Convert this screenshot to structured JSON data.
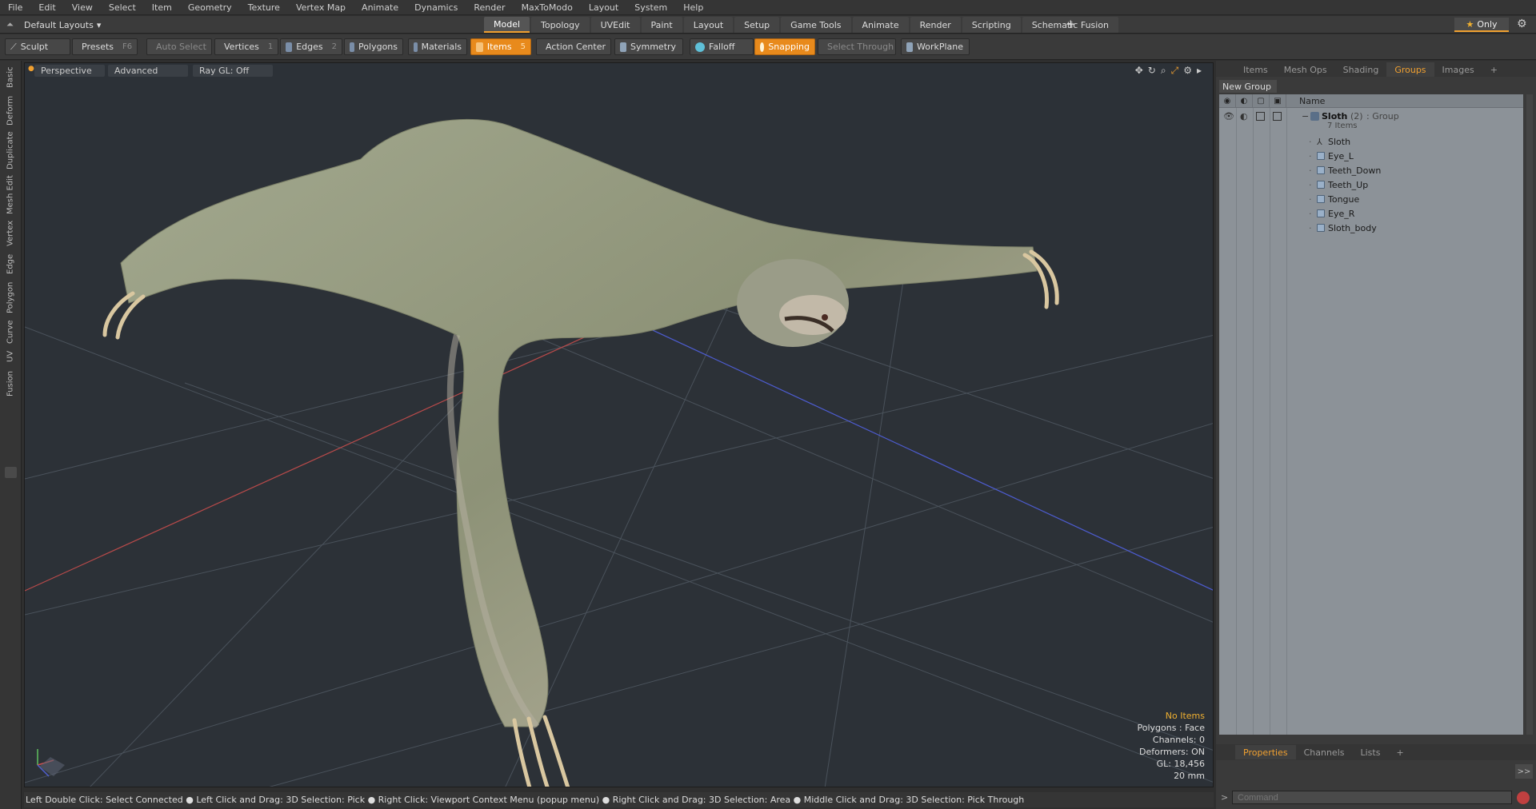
{
  "menu": [
    "File",
    "Edit",
    "View",
    "Select",
    "Item",
    "Geometry",
    "Texture",
    "Vertex Map",
    "Animate",
    "Dynamics",
    "Render",
    "MaxToModo",
    "Layout",
    "System",
    "Help"
  ],
  "layout_selector": "Default Layouts",
  "tabs": [
    {
      "label": "Model",
      "active": true
    },
    {
      "label": "Topology",
      "active": false
    },
    {
      "label": "UVEdit",
      "active": false
    },
    {
      "label": "Paint",
      "active": false
    },
    {
      "label": "Layout",
      "active": false
    },
    {
      "label": "Setup",
      "active": false
    },
    {
      "label": "Game Tools",
      "active": false
    },
    {
      "label": "Animate",
      "active": false
    },
    {
      "label": "Render",
      "active": false
    },
    {
      "label": "Scripting",
      "active": false
    },
    {
      "label": "Schematic Fusion",
      "active": false
    }
  ],
  "tab_plus": "+",
  "only_label": "Only",
  "toolbar": {
    "sculpt": "Sculpt",
    "presets": "Presets",
    "presets_key": "F6",
    "auto_select": "Auto Select",
    "vertices": "Vertices",
    "vertices_key": "1",
    "edges": "Edges",
    "edges_key": "2",
    "polygons": "Polygons",
    "materials": "Materials",
    "items": "Items",
    "items_key": "5",
    "action_center": "Action Center",
    "symmetry": "Symmetry",
    "falloff": "Falloff",
    "snapping": "Snapping",
    "select_through": "Select Through",
    "workplane": "WorkPlane"
  },
  "left_tabs": [
    "Basic",
    "Deform",
    "Duplicate",
    "Mesh Edit",
    "Vertex",
    "Edge",
    "Polygon",
    "Curve",
    "UV",
    "Fusion"
  ],
  "viewport": {
    "perspective": "Perspective",
    "advanced": "Advanced",
    "raygl": "Ray GL: Off",
    "info": {
      "no_items": "No Items",
      "polygons": "Polygons : Face",
      "channels": "Channels: 0",
      "deformers": "Deformers: ON",
      "gl": "GL: 18,456",
      "scale": "20 mm"
    }
  },
  "status_bar": "Left Double Click: Select Connected ● Left Click and Drag: 3D Selection: Pick ● Right Click: Viewport Context Menu (popup menu) ● Right Click and Drag: 3D Selection: Area ● Middle Click and Drag: 3D Selection: Pick Through",
  "right_panel": {
    "tabs": [
      {
        "label": "Items",
        "active": false
      },
      {
        "label": "Mesh Ops",
        "active": false
      },
      {
        "label": "Shading",
        "active": false
      },
      {
        "label": "Groups",
        "active": true
      },
      {
        "label": "Images",
        "active": false
      }
    ],
    "tabs_plus": "+",
    "new_group": "New Group",
    "name_header": "Name",
    "group": {
      "name": "Sloth",
      "count": "(2)",
      "type": ": Group",
      "items_count": "7 Items"
    },
    "items": [
      "Sloth",
      "Eye_L",
      "Teeth_Down",
      "Teeth_Up",
      "Tongue",
      "Eye_R",
      "Sloth_body"
    ],
    "bottom_tabs": [
      {
        "label": "Properties",
        "active": true
      },
      {
        "label": "Channels",
        "active": false
      },
      {
        "label": "Lists",
        "active": false
      }
    ],
    "bottom_plus": "+",
    "command_placeholder": "Command"
  }
}
